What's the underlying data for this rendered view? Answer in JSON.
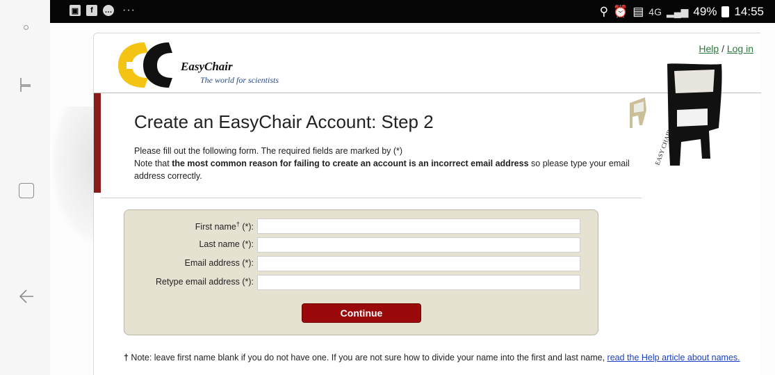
{
  "status_bar": {
    "left_icons": [
      "image-icon",
      "facebook-icon",
      "chat-icon"
    ],
    "more": "···",
    "right_icons": [
      "location-icon",
      "alarm-icon",
      "screenshot-icon"
    ],
    "network": "4G",
    "battery": "49%",
    "time": "14:55"
  },
  "nav": {
    "buttons": [
      "menu-dot",
      "recent-apps",
      "home",
      "back"
    ]
  },
  "header": {
    "logo_name": "EasyChair",
    "logo_tagline": "The world for scientists",
    "help_link": "Help",
    "separator": "/",
    "login_link": "Log in"
  },
  "main": {
    "title": "Create an EasyChair Account: Step 2",
    "intro_line1": "Please fill out the following form. The required fields are marked by (*)",
    "intro_line2_pre": "Note that ",
    "intro_line2_bold": "the most common reason for failing to create an account is an incorrect email address",
    "intro_line2_post": " so please type your email address correctly."
  },
  "form": {
    "fields": [
      {
        "label": "First name",
        "sup": "†",
        "suffix": " (*):",
        "value": ""
      },
      {
        "label": "Last name (*):",
        "value": ""
      },
      {
        "label": "Email address (*):",
        "value": ""
      },
      {
        "label": "Retype email address (*):",
        "value": ""
      }
    ],
    "continue_label": "Continue"
  },
  "footnote": {
    "mark": "†",
    "text": " Note: leave first name blank if you do not have one. If you are not sure how to divide your name into the first and last name, ",
    "link": "read the Help article about names."
  },
  "colors": {
    "accent_red": "#9b0a0a",
    "form_bg": "#e5e2d2",
    "link_green": "#2a7a3a",
    "link_blue": "#1a3ec4"
  }
}
